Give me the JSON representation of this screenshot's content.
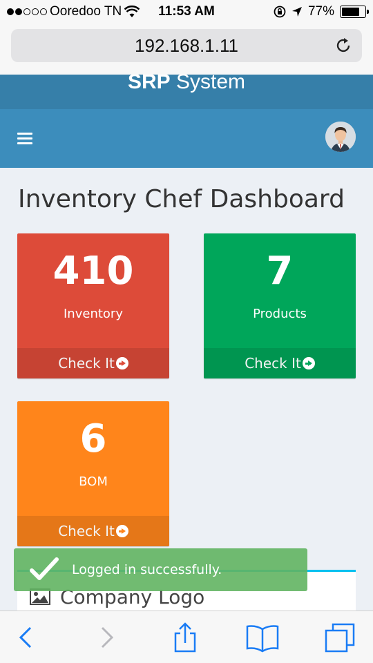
{
  "status_bar": {
    "carrier": "Ooredoo TN",
    "time": "11:53 AM",
    "battery": "77%",
    "signal_bars_filled": 2,
    "signal_bars_total": 5,
    "battery_level": 0.77
  },
  "browser": {
    "url": "192.168.1.11",
    "icons": [
      "reload-icon",
      "back-icon",
      "forward-icon",
      "share-icon",
      "bookmarks-icon",
      "tabs-icon"
    ]
  },
  "app": {
    "brand_bold": "SRP",
    "brand_rest": " System"
  },
  "page": {
    "title": "Inventory Chef Dashboard"
  },
  "boxes": [
    {
      "value": "410",
      "label": "Inventory",
      "link": "Check It",
      "color": "#dd4b39"
    },
    {
      "value": "7",
      "label": "Products",
      "link": "Check It",
      "color": "#00a65a"
    },
    {
      "value": "6",
      "label": "BOM",
      "link": "Check It",
      "color": "#ff851b"
    }
  ],
  "panel": {
    "title": "Company Logo"
  },
  "toast": {
    "message": "Logged in successfully."
  },
  "colors": {
    "header_dark": "#367fa9",
    "header": "#3c8dbc",
    "panel_accent": "#00c0ef",
    "ios_blue": "#1a7cf5"
  }
}
